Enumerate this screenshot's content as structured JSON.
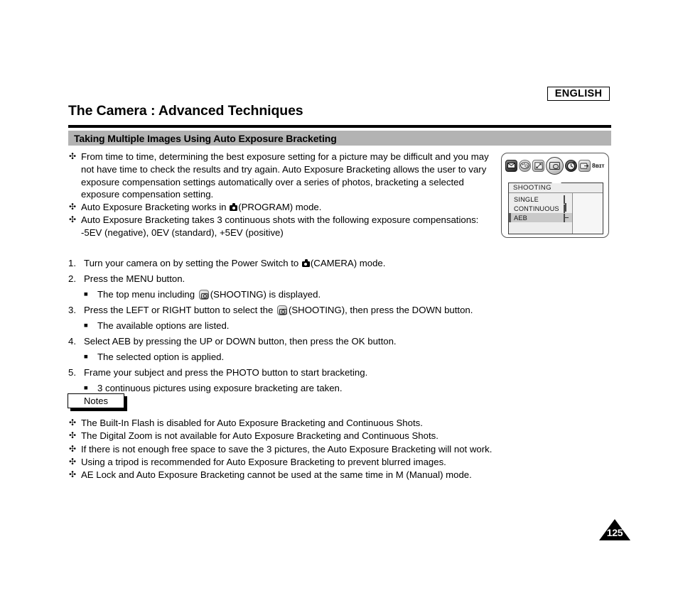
{
  "language_badge": "ENGLISH",
  "header": {
    "title": "The Camera : Advanced Techniques",
    "section_title": "Taking Multiple Images Using Auto Exposure Bracketing"
  },
  "intro_bullets": [
    "From time to time, determining the best exposure setting for a picture may be difficult and you may not have time to check the results and try again. Auto Exposure Bracketing allows the user to vary exposure compensation settings automatically over a series of photos, bracketing a selected exposure compensation setting.",
    "Auto Exposure Bracketing works in  (PROGRAM) mode.",
    "Auto Exposure Bracketing takes 3 continuous shots with the following exposure compensations: -5EV (negative), 0EV (standard), +5EV (positive)"
  ],
  "intro_bullet_parts": {
    "b2_pre": "Auto Exposure Bracketing works in",
    "b2_post": "(PROGRAM) mode.",
    "b3_line1": "Auto Exposure Bracketing takes 3 continuous shots with the following exposure compensations:",
    "b3_line2": "-5EV (negative), 0EV (standard), +5EV (positive)"
  },
  "steps": [
    {
      "num": "1.",
      "pre": "Turn your camera on by setting the Power Switch to",
      "post": "(CAMERA) mode.",
      "icon": "camera-solid-icon"
    },
    {
      "num": "2.",
      "pre": "Press the MENU button.",
      "post": "",
      "icon": ""
    },
    {
      "num": "3.",
      "pre": "Press the LEFT or RIGHT button to select the",
      "post": "(SHOOTING), then press the DOWN button.",
      "icon": "shooting-icon"
    },
    {
      "num": "4.",
      "pre": "Select AEB by pressing the UP or DOWN button, then press the OK button.",
      "post": "",
      "icon": ""
    },
    {
      "num": "5.",
      "pre": "Frame your subject and press the PHOTO button to start bracketing.",
      "post": "",
      "icon": ""
    }
  ],
  "sub_notes": {
    "after_step2_pre": "The top menu including",
    "after_step2_post": "(SHOOTING) is displayed.",
    "after_step3": "The available options are listed.",
    "after_step4": "The selected option is applied.",
    "after_step5": "3 continuous pictures using exposure bracketing are taken."
  },
  "notes": {
    "label": "Notes",
    "items": [
      "The Built-In Flash is disabled for Auto Exposure Bracketing and Continuous Shots.",
      "The Digital Zoom is not available for Auto Exposure Bracketing and Continuous Shots.",
      "If there is not enough free space to save the 3 pictures, the Auto Exposure Bracketing will not work.",
      "Using a tripod is recommended for Auto Exposure Bracketing to prevent blurred images.",
      "AE Lock and Auto Exposure Bracketing cannot be used at the same time in M (Manual) mode."
    ]
  },
  "lcd_figure": {
    "tab_icons": [
      {
        "name": "mail-icon",
        "glyph": "✉"
      },
      {
        "name": "palette-icon",
        "glyph": ""
      },
      {
        "name": "image-size-icon",
        "glyph": ""
      },
      {
        "name": "shooting-camera-icon",
        "glyph": ""
      },
      {
        "name": "self-timer-icon",
        "glyph": ""
      },
      {
        "name": "playback-icon",
        "glyph": ""
      },
      {
        "name": "bit-depth-icon",
        "glyph": "8ʙɪᴛ"
      }
    ],
    "menu_title": "SHOOTING",
    "options": [
      {
        "label": "SINGLE",
        "selected": false
      },
      {
        "label": "CONTINUOUS",
        "selected": false
      },
      {
        "label": "AEB",
        "selected": true
      }
    ]
  },
  "page_number": "125",
  "colors": {
    "section_bar": "#b3b3b3",
    "rule": "#000000",
    "lcd_panel": "#ededed",
    "lcd_highlight": "#c9c9c9"
  },
  "bullet_glyph": "✣",
  "square_glyph": "■"
}
